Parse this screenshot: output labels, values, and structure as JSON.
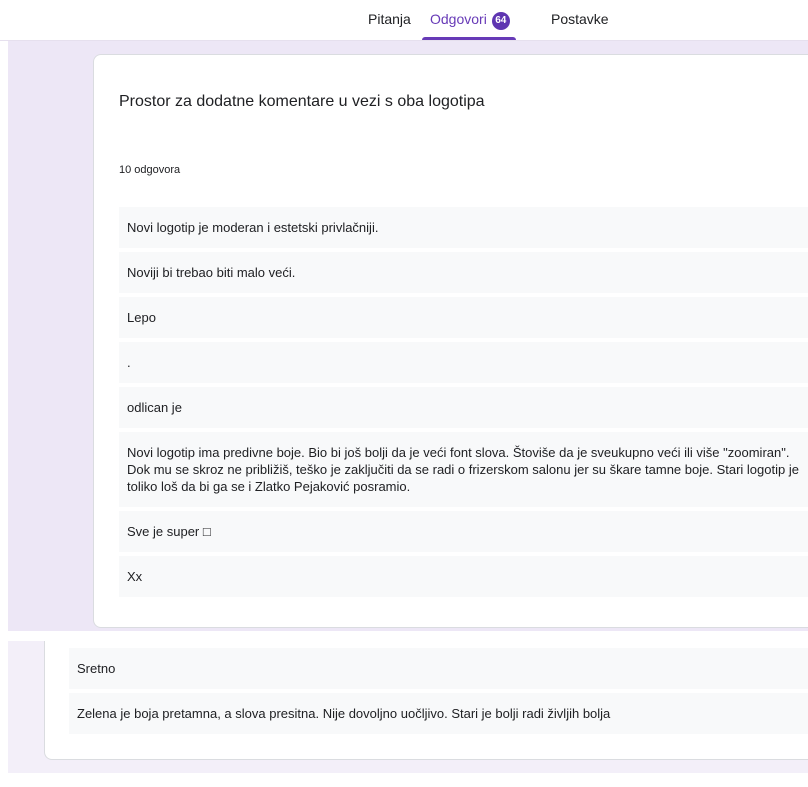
{
  "tabs": [
    {
      "label": "Pitanja",
      "active": false
    },
    {
      "label": "Odgovori",
      "active": true,
      "badge": "64"
    },
    {
      "label": "Postavke",
      "active": false
    }
  ],
  "question": {
    "title": "Prostor za dodatne komentare u vezi s oba logotipa",
    "count_label": "10 odgovora"
  },
  "responses": [
    "Novi logotip je moderan i estetski privlačniji.",
    "Noviji bi trebao biti malo veći.",
    "Lepo",
    ".",
    "odlican je",
    "Novi logotip ima predivne boje. Bio bi još bolji da je veći font slova. Štoviše da je sveukupno veći ili više \"zoomiran\". Dok mu se skroz ne približiš, teško je zaključiti da se radi o frizerskom salonu jer su škare tamne boje. Stari logotip je toliko loš da bi ga se i Zlatko Pejaković posramio.",
    "Sve je super □",
    "Xx"
  ],
  "responses_continued": [
    "Sretno",
    "Zelena je boja pretamna, a slova presitna. Nije dovoljno uočljivo. Stari je bolji radi življih bolja"
  ],
  "colors": {
    "accent": "#673ab7",
    "badge": "#5e35b1",
    "band": "#ede7f6",
    "response_bg": "#f8f9fa"
  }
}
